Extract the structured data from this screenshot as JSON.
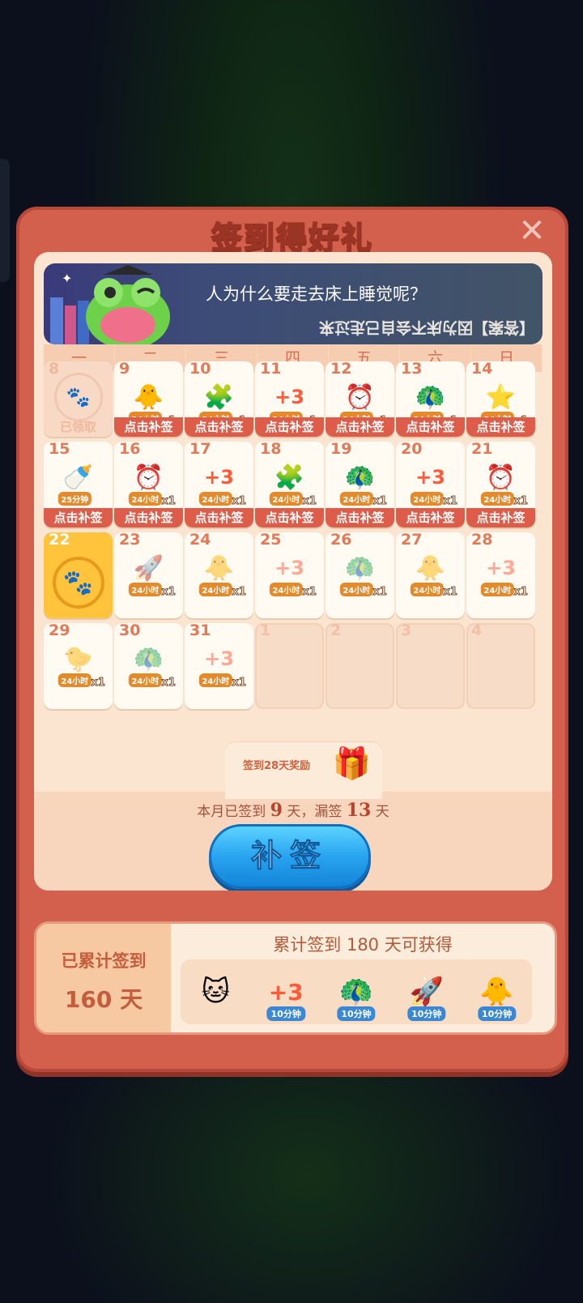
{
  "title": "签到得好礼",
  "close_icon": "close-icon",
  "banner": {
    "question": "人为什么要走去床上睡觉呢？",
    "answer": "【答案】因为床不会自己走过来"
  },
  "weekdays": [
    "一",
    "二",
    "三",
    "四",
    "五",
    "六",
    "日"
  ],
  "days": [
    {
      "n": "8",
      "state": "claimed",
      "label": "已领取"
    },
    {
      "n": "9",
      "state": "missed",
      "icon": "🐥",
      "tag": "24小时",
      "x": "x1",
      "btn": "点击补签"
    },
    {
      "n": "10",
      "state": "missed",
      "icon": "🧩",
      "tag": "24小时",
      "x": "x1",
      "btn": "点击补签"
    },
    {
      "n": "11",
      "state": "missed",
      "icon": "+3",
      "tag": "24小时",
      "x": "x1",
      "btn": "点击补签"
    },
    {
      "n": "12",
      "state": "missed",
      "icon": "⏰",
      "tag": "24小时",
      "x": "x1",
      "btn": "点击补签"
    },
    {
      "n": "13",
      "state": "missed",
      "icon": "🦚",
      "tag": "24小时",
      "x": "x1",
      "btn": "点击补签"
    },
    {
      "n": "14",
      "state": "missed",
      "icon": "⭐",
      "tag": "24小时",
      "x": "x1",
      "btn": "点击补签"
    },
    {
      "n": "15",
      "state": "missed",
      "icon": "🍼",
      "tag": "25分钟",
      "x": "",
      "btn": "点击补签"
    },
    {
      "n": "16",
      "state": "missed",
      "icon": "⏰",
      "tag": "24小时",
      "x": "x1",
      "btn": "点击补签"
    },
    {
      "n": "17",
      "state": "missed",
      "icon": "+3",
      "tag": "24小时",
      "x": "x1",
      "btn": "点击补签"
    },
    {
      "n": "18",
      "state": "missed",
      "icon": "🧩",
      "tag": "24小时",
      "x": "x1",
      "btn": "点击补签"
    },
    {
      "n": "19",
      "state": "missed",
      "icon": "🦚",
      "tag": "24小时",
      "x": "x1",
      "btn": "点击补签"
    },
    {
      "n": "20",
      "state": "missed",
      "icon": "+3",
      "tag": "24小时",
      "x": "x1",
      "btn": "点击补签"
    },
    {
      "n": "21",
      "state": "missed",
      "icon": "⏰",
      "tag": "24小时",
      "x": "x1",
      "btn": "点击补签"
    },
    {
      "n": "22",
      "state": "today"
    },
    {
      "n": "23",
      "state": "future",
      "icon": "🚀",
      "tag": "24小时",
      "x": "x1"
    },
    {
      "n": "24",
      "state": "future",
      "icon": "🐥",
      "tag": "24小时",
      "x": "x1"
    },
    {
      "n": "25",
      "state": "future",
      "icon": "+3",
      "tag": "24小时",
      "x": "x1"
    },
    {
      "n": "26",
      "state": "future",
      "icon": "🦚",
      "tag": "24小时",
      "x": "x1"
    },
    {
      "n": "27",
      "state": "future",
      "icon": "🐥",
      "tag": "24小时",
      "x": "x1"
    },
    {
      "n": "28",
      "state": "future",
      "icon": "+3",
      "tag": "24小时",
      "x": "x1"
    },
    {
      "n": "29",
      "state": "future",
      "icon": "🐤",
      "tag": "24小时",
      "x": "x1"
    },
    {
      "n": "30",
      "state": "future",
      "icon": "🦚",
      "tag": "24小时",
      "x": "x1"
    },
    {
      "n": "31",
      "state": "future",
      "icon": "+3",
      "tag": "24小时",
      "x": "x1"
    },
    {
      "n": "1",
      "state": "empty"
    },
    {
      "n": "2",
      "state": "empty"
    },
    {
      "n": "3",
      "state": "empty"
    },
    {
      "n": "4",
      "state": "empty"
    }
  ],
  "bonus": {
    "label": "签到28天奖励",
    "icon": "gift-icon"
  },
  "tally": {
    "prefix": "本月已签到",
    "signed": "9",
    "mid": "天，漏签",
    "missed": "13",
    "suffix": "天"
  },
  "makeup_button": "补签",
  "cumulative": {
    "left_label": "已累计签到",
    "left_value": "160 天",
    "title": "累计签到 180 天可获得",
    "rewards": [
      {
        "icon": "🐱",
        "tag": ""
      },
      {
        "icon": "+3",
        "tag": "10分钟"
      },
      {
        "icon": "🦚",
        "tag": "10分钟"
      },
      {
        "icon": "🚀",
        "tag": "10分钟"
      },
      {
        "icon": "🐥",
        "tag": "10分钟"
      }
    ]
  }
}
